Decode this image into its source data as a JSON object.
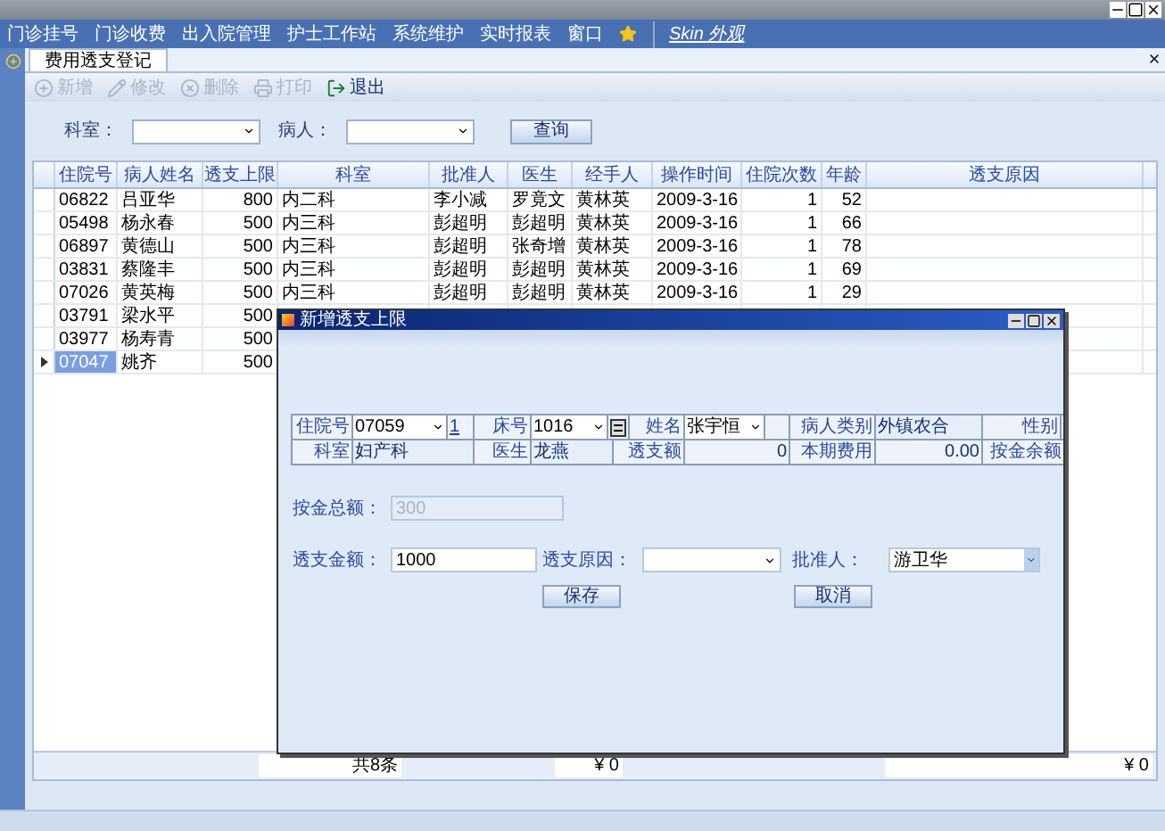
{
  "menu": [
    {
      "label": "门诊挂号",
      "kind": "item"
    },
    {
      "label": "门诊收费",
      "kind": "item"
    },
    {
      "label": "出入院管理",
      "kind": "item"
    },
    {
      "label": "护士工作站",
      "kind": "item"
    },
    {
      "label": "系统维护",
      "kind": "item"
    },
    {
      "label": "实时报表",
      "kind": "item"
    },
    {
      "label": "窗口",
      "kind": "item"
    },
    {
      "kind": "icon"
    },
    {
      "label": "Skin 外观",
      "kind": "link"
    }
  ],
  "tab": {
    "label": "费用透支登记",
    "selected": true
  },
  "toolbar": [
    {
      "label": "新增",
      "disabled": true
    },
    {
      "label": "修改",
      "disabled": true
    },
    {
      "label": "删除",
      "disabled": true
    },
    {
      "label": "打印",
      "disabled": true
    },
    {
      "label": "退出",
      "disabled": false
    }
  ],
  "search": {
    "fields": [
      {
        "label": "科室："
      },
      {
        "label": "病人："
      }
    ],
    "button": "查询"
  },
  "table": {
    "columns": [
      "住院号",
      "病人姓名",
      "透支上限",
      "科室",
      "批准人",
      "医生",
      "经手人",
      "操作时间",
      "住院次数",
      "年龄",
      "透支原因"
    ],
    "rows": [
      {
        "cells": [
          "06822",
          "吕亚华",
          "800",
          "内二科",
          "李小减",
          "罗竟文",
          "黄林英",
          "2009-3-16",
          "1",
          "52",
          ""
        ],
        "selected": false
      },
      {
        "cells": [
          "05498",
          "杨永春",
          "500",
          "内三科",
          "彭超明",
          "彭超明",
          "黄林英",
          "2009-3-16",
          "1",
          "66",
          ""
        ],
        "selected": false
      },
      {
        "cells": [
          "06897",
          "黄德山",
          "500",
          "内三科",
          "彭超明",
          "张奇增",
          "黄林英",
          "2009-3-16",
          "1",
          "78",
          ""
        ],
        "selected": false
      },
      {
        "cells": [
          "03831",
          "蔡隆丰",
          "500",
          "内三科",
          "彭超明",
          "彭超明",
          "黄林英",
          "2009-3-16",
          "1",
          "69",
          ""
        ],
        "selected": false
      },
      {
        "cells": [
          "07026",
          "黄英梅",
          "500",
          "内三科",
          "彭超明",
          "彭超明",
          "黄林英",
          "2009-3-16",
          "1",
          "29",
          ""
        ],
        "selected": false
      },
      {
        "cells": [
          "03791",
          "梁水平",
          "500"
        ],
        "selected": false
      },
      {
        "cells": [
          "03977",
          "杨寿青",
          "500"
        ],
        "selected": false
      },
      {
        "cells": [
          "07047",
          "姚齐",
          "500"
        ],
        "selected": true
      }
    ]
  },
  "footer": {
    "count": "共8条",
    "total_1": "¥ 0",
    "total_2": "¥ 0"
  },
  "dialog": {
    "title": "新增透支上限",
    "info_rows": [
      [
        {
          "kind": "label",
          "text": "住院号"
        },
        {
          "kind": "dropdown",
          "text": "07059"
        },
        {
          "kind": "link",
          "text": "1"
        },
        {
          "kind": "label",
          "text": "床号"
        },
        {
          "kind": "dropdown",
          "text": "1016"
        },
        {
          "kind": "icon"
        },
        {
          "kind": "label",
          "text": "姓名"
        },
        {
          "kind": "dropdown",
          "text": "张宇恒"
        },
        {
          "kind": "empty"
        },
        {
          "kind": "label",
          "text": "病人类别"
        },
        {
          "kind": "value",
          "text": "外镇农合"
        },
        {
          "kind": "label",
          "text": "性别"
        }
      ],
      [
        {
          "kind": "label",
          "text": "科室"
        },
        {
          "kind": "value",
          "text": "妇产科"
        },
        {
          "kind": "label",
          "text": "医生"
        },
        {
          "kind": "value",
          "text": "龙燕"
        },
        {
          "kind": "label",
          "text": "透支额"
        },
        {
          "kind": "number",
          "text": "0"
        },
        {
          "kind": "label",
          "text": "本期费用"
        },
        {
          "kind": "number",
          "text": "0.00"
        },
        {
          "kind": "label",
          "text": "按金余额"
        }
      ]
    ],
    "deposit_total": {
      "label": "按金总额：",
      "value": "300",
      "disabled": true
    },
    "amount": {
      "label": "透支金额：",
      "value": "1000"
    },
    "reason": {
      "label": "透支原因："
    },
    "approver": {
      "label": "批准人：",
      "value": "游卫华"
    },
    "buttons": [
      "保存",
      "取消"
    ]
  }
}
